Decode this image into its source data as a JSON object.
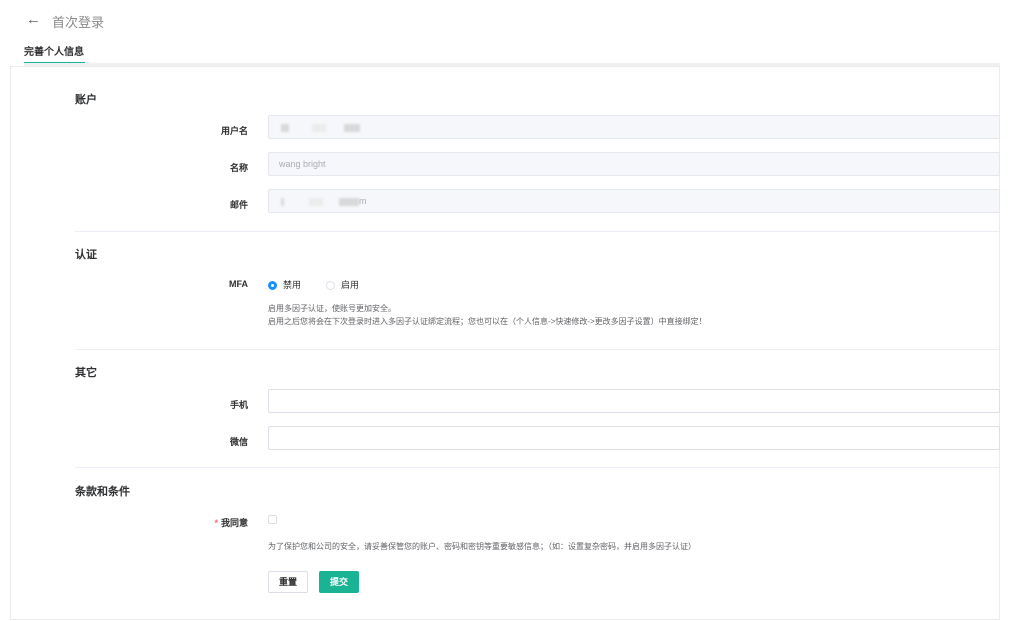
{
  "header": {
    "back_icon": "←",
    "title": "首次登录"
  },
  "tabs": [
    {
      "label": "完善个人信息",
      "active": true
    }
  ],
  "sections": {
    "account": {
      "title": "账户",
      "username_label": "用户名",
      "name_label": "名称",
      "name_value": "wang bright",
      "email_label": "邮件",
      "email_visible_suffix": "m"
    },
    "auth": {
      "title": "认证",
      "mfa_label": "MFA",
      "options": [
        "禁用",
        "启用"
      ],
      "selected": "禁用",
      "help_line1": "启用多因子认证，使账号更加安全。",
      "help_line2": "启用之后您将会在下次登录时进入多因子认证绑定流程；您也可以在（个人信息->快速修改->更改多因子设置）中直接绑定！"
    },
    "other": {
      "title": "其它",
      "phone_label": "手机",
      "wechat_label": "微信"
    },
    "terms": {
      "title": "条款和条件",
      "required_mark": "*",
      "agree_label": "我同意",
      "help": "为了保护您和公司的安全，请妥善保管您的账户、密码和密钥等重要敏感信息；（如：设置复杂密码，并启用多因子认证）"
    }
  },
  "buttons": {
    "reset": "重置",
    "submit": "提交"
  },
  "colors": {
    "accent": "#1ab394",
    "radio": "#1890ff",
    "required": "#f56c6c"
  }
}
